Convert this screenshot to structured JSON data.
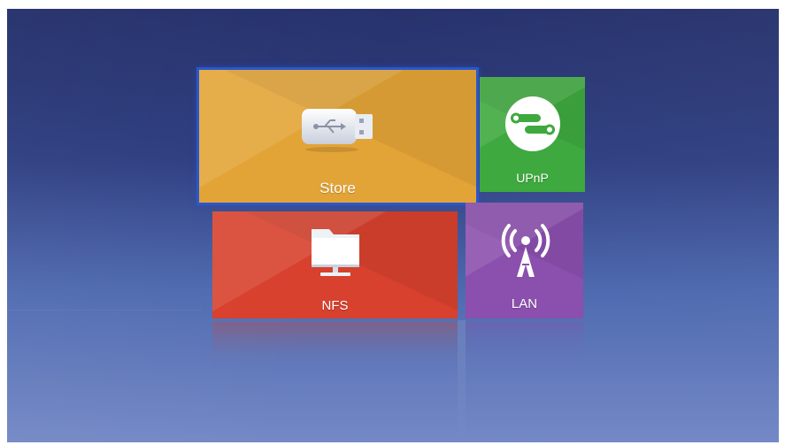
{
  "app": {
    "tiles": {
      "store": {
        "label": "Store",
        "icon": "usb-drive-icon",
        "color": "#e3a437",
        "focused": true
      },
      "upnp": {
        "label": "UPnP",
        "icon": "upnp-link-icon",
        "color": "#3ea93e"
      },
      "nfs": {
        "label": "NFS",
        "icon": "network-folder-icon",
        "color": "#d7412d"
      },
      "lan": {
        "label": "LAN",
        "icon": "wireless-antenna-icon",
        "color": "#8b4fae"
      }
    },
    "focus_color": "#2c57c9",
    "background": {
      "top": "#1f2b67",
      "bottom": "#7489c6"
    }
  }
}
